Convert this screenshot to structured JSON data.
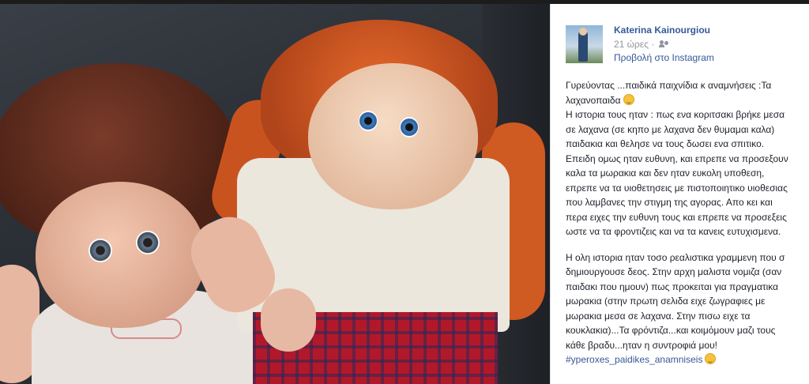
{
  "post": {
    "author": "Katerina Kainourgiou",
    "time": "21 ώρες ·",
    "via_link": "Προβολή στο Instagram",
    "lines": [
      "Γυρεύοντας ...παιδικά παιχνίδια κ αναμνήσεις :Τα",
      "λαχανοπαιδα",
      "Η ιστορια τους ηταν : πως ενα κοριτσακι βρήκε μεσα",
      "σε λαχανα (σε κηπο με λαχανα δεν θυμαμαι καλα)",
      "παιδακια και θελησε να τους δωσει ενα σπιτικο.",
      "Επειδη ομως ηταν ευθυνη, και επρεπε να προσεξουν",
      "καλα τα μωρακια και δεν ηταν ευκολη υποθεση,",
      "επρεπε να τα υιοθετησεις με πιστοποιητικο υιοθεσιας",
      "που λαμβανες την στιγμη της αγορας. Απο κει και",
      "περα ειχες την ευθυνη τους και επρεπε να προσεξεις",
      "ωστε να τα φροντιζεις και να τα κανεις ευτυχισμενα.",
      "Η ολη ιστορια ηταν τοσο ρεαλιστικα γραμμενη που σ",
      "δημιουργουσε δεος. Στην αρχη μαλιστα νομιζα (σαν",
      "παιδακι που ημουν) πως προκειται για πραγματικα",
      "μωρακια  (στην πρωτη σελιδα ειχε ζωγραφιες με",
      "μωρακια μεσα σε λαχανα. Στην πισω ειχε τα",
      "κουκλακια)...Τα φρόντιζα...και κοιμόμουν μαζι τους",
      "κάθε βραδυ...ηταν η συντροφιά μου!"
    ],
    "hashtag": "#yperoxes_paidikes_anamniseis"
  },
  "icons": {
    "audience": "friends-icon",
    "emoji": "smiley-emoji-icon"
  }
}
